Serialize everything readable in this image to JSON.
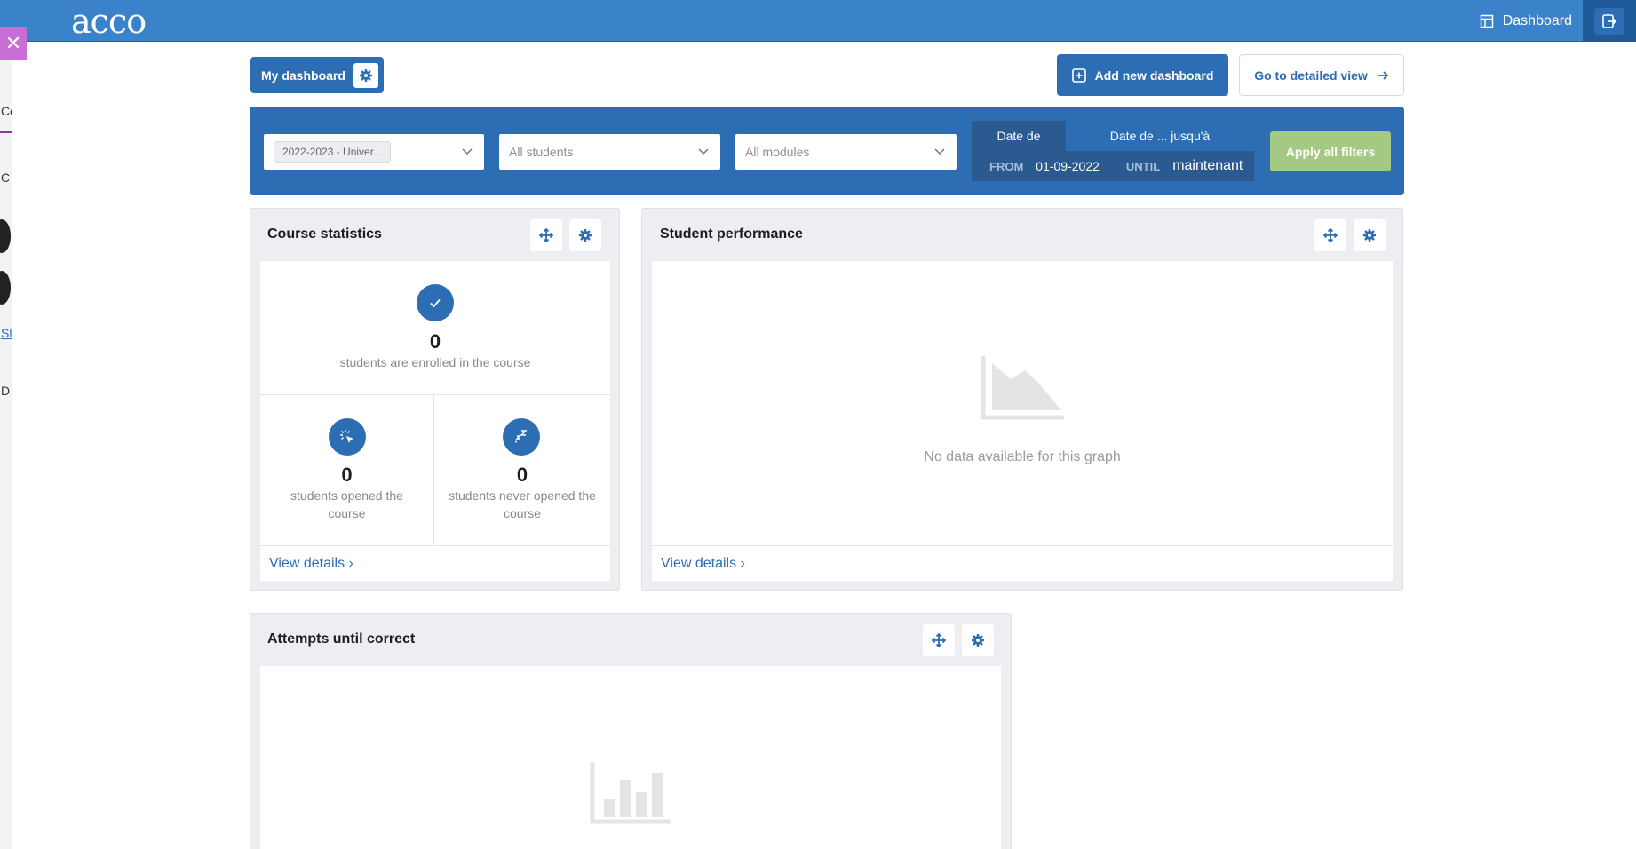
{
  "topbar": {
    "logo": "acco",
    "nav_label": "Dashboard",
    "nav_icon": "layout-icon",
    "logout_icon": "logout-icon"
  },
  "left_strip": {
    "fragments": [
      "Co",
      "C",
      "Sl",
      "D"
    ]
  },
  "header": {
    "my_dashboard": "My dashboard",
    "add_dashboard": "Add new dashboard",
    "go_detailed": "Go to detailed view"
  },
  "filters": {
    "year_chip": "2022-2023 - Univer...",
    "students": "All students",
    "modules": "All modules",
    "date_from_head": "Date de",
    "date_until_head": "Date de ... jusqu'à",
    "from_label": "FROM",
    "from_value": "01-09-2022",
    "until_label": "UNTIL",
    "until_value": "maintenant",
    "apply": "Apply all filters"
  },
  "widgets": {
    "course_stats": {
      "title": "Course statistics",
      "enrolled_count": "0",
      "enrolled_text": "students are enrolled in the course",
      "opened_count": "0",
      "opened_text": "students opened the course",
      "never_count": "0",
      "never_text": "students never opened the course",
      "view_details": "View details ›"
    },
    "student_perf": {
      "title": "Student performance",
      "no_data": "No data available for this graph",
      "view_details": "View details ›"
    },
    "attempts": {
      "title": "Attempts until correct"
    }
  },
  "colors": {
    "primary": "#2d6db3",
    "topbar": "#3a82c9",
    "apply": "#a3c983"
  }
}
